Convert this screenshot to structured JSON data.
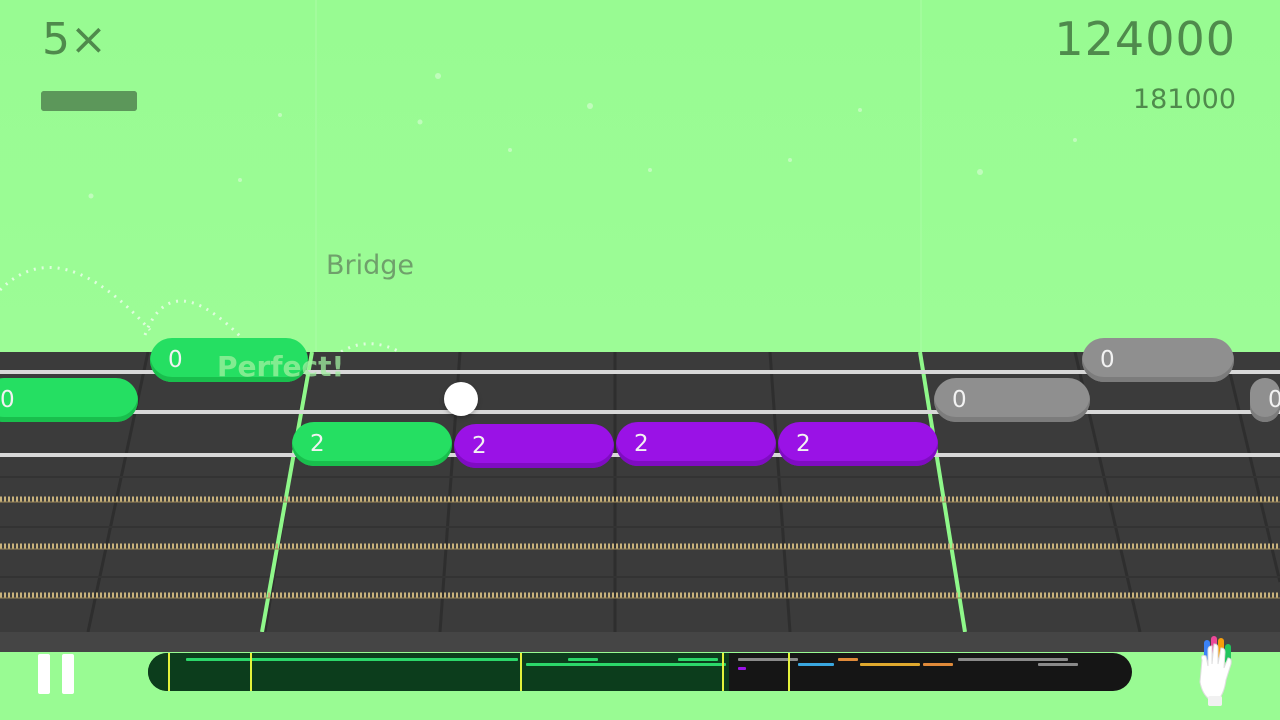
{
  "hud": {
    "multiplier": "5×",
    "score": "124000",
    "target_score": "181000",
    "combo_level": 1.0
  },
  "section_label": "Bridge",
  "feedback_text": "Perfect!",
  "notes": {
    "n1": "0",
    "n2": "0",
    "n3": "2",
    "n4": "2",
    "n5": "2",
    "n6": "2",
    "n7": "0",
    "n8": "0",
    "n9": "0"
  },
  "colors": {
    "background": "#99fb93",
    "played_note": "#25df62",
    "active_note": "#9a12e6",
    "upcoming_note": "#8f8f8f",
    "fretboard": "#3c3c3c"
  },
  "song_progress": 0.59,
  "icons": {
    "pause": "pause-icon",
    "hand": "hand-glove-icon"
  }
}
